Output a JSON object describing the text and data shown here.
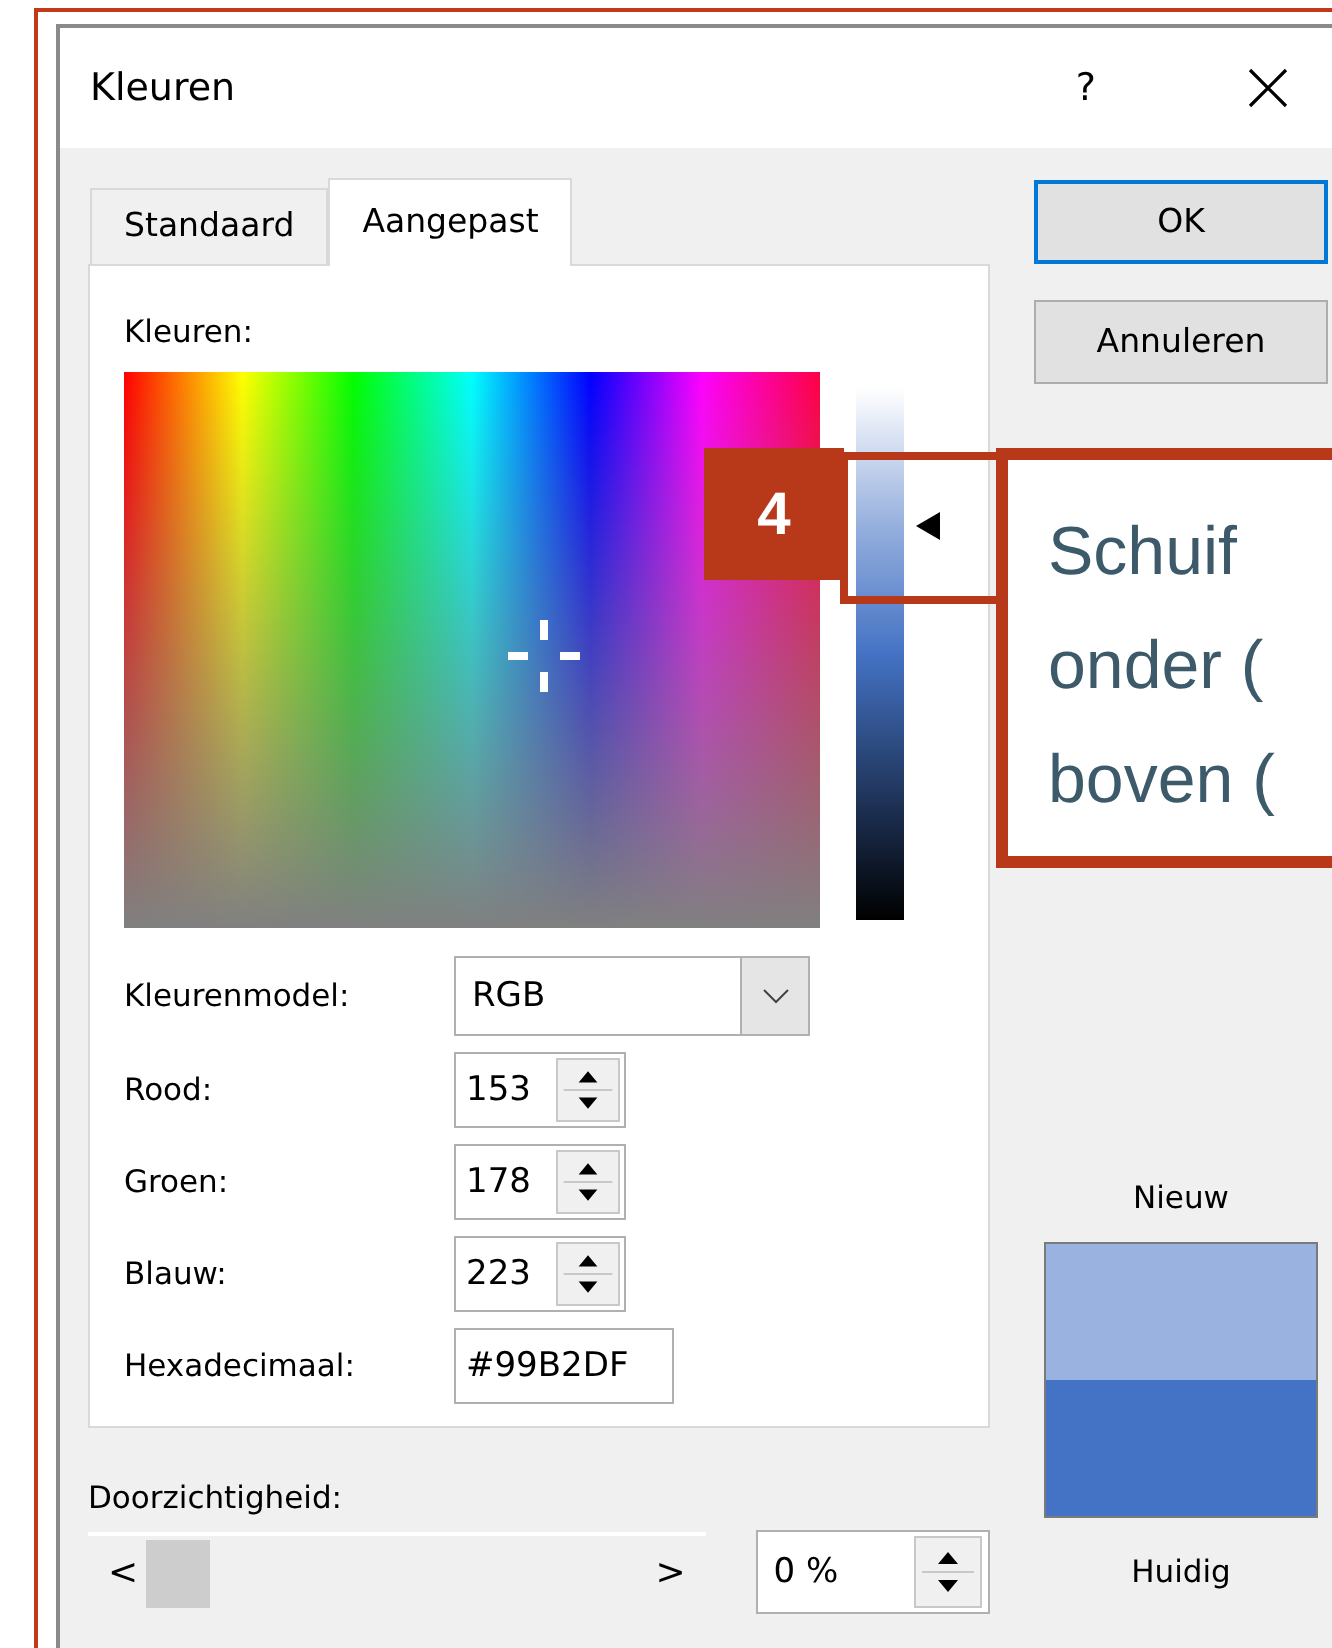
{
  "window": {
    "title": "Kleuren",
    "help": "?"
  },
  "tabs": [
    {
      "label": "Standaard",
      "selected": false
    },
    {
      "label": "Aangepast",
      "selected": true
    }
  ],
  "colors_label": "Kleuren:",
  "luminance": {
    "level": 0.74
  },
  "fields": [
    {
      "kind": "select",
      "label": "Kleurenmodel:",
      "value": "RGB"
    },
    {
      "kind": "spin",
      "label": "Rood:",
      "value": "153"
    },
    {
      "kind": "spin",
      "label": "Groen:",
      "value": "178"
    },
    {
      "kind": "spin",
      "label": "Blauw:",
      "value": "223"
    },
    {
      "kind": "text",
      "label": "Hexadecimaal:",
      "value": "#99B2DF"
    }
  ],
  "transparency": {
    "label": "Doorzichtigheid:",
    "level": 0,
    "left": "<",
    "right": ">",
    "value": "0 %"
  },
  "buttons": [
    {
      "label": "OK",
      "default": true
    },
    {
      "label": "Annuleren",
      "default": false
    }
  ],
  "preview": [
    {
      "label": "Nieuw",
      "color": "#99b2df"
    },
    {
      "label": "Huidig",
      "color": "#4472c4"
    }
  ],
  "callout": {
    "number": "4",
    "lines": [
      "Schuif",
      "onder (",
      "boven ("
    ]
  }
}
